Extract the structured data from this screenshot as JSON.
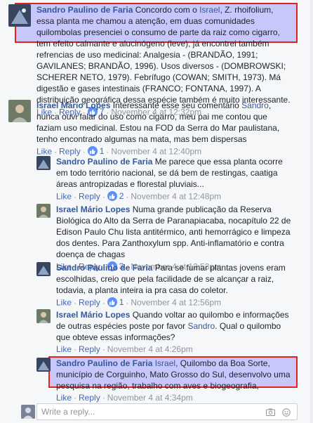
{
  "comments": [
    {
      "name": "Sandro Paulino de Faria",
      "text_lines": [
        " Concordo com o ",
        "Israel",
        ", Z. rhoifolium, essa planta me chamou a atenção, em duas comunidades quilombolas presenciei o consumo de parte da raiz como cigarro, tem efeito calmante e alucinógeno (leve), já encontrei também refrencias de uso medicinal: Analgesia - (BRANDÃO, 1991; GAVILANES; BRANDÃO, 1996). Usos diversos - (DOMBROWSKI; SCHERER NETO, 1979). Febrífugo (COWAN; SMITH, 1973). Má digestão e gases intestinais (FRANCO; FONTANA, 1997). A distribuição geográfica dessa espécie também é muito interessante."
      ],
      "like": "Like",
      "reply": "Reply",
      "likes": "7",
      "time": "November 4 at 12:32pm"
    },
    {
      "name": "Israel Mário Lopes",
      "text_a": " Interessante esse seu comentário ",
      "mention": "Sandro",
      "text_b": ", nunca ouvi falar do uso como cigarro, meu pai me contou que faziam uso medicinal. Estou na FOD da Serra do Mar paulistana, tenho encontrado algumas na mata, mas bem dispersas",
      "like": "Like",
      "reply": "Reply",
      "likes": "1",
      "time": "November 4 at 12:40pm"
    },
    {
      "name": "Sandro Paulino de Faria",
      "text": " Me parece que essa planta ocorre em todo território nacional, se dá bem de restingas, caatiga áreas antropizadas e florestal pluviais...",
      "like": "Like",
      "reply": "Reply",
      "likes": "2",
      "time": "November 4 at 12:48pm"
    },
    {
      "name": "Israel Mário Lopes",
      "text": " Numa grande publicação da Reserva Biológica do Alto da Serra de Paranapiacaba, nocapítulo 22 de Edison Paulo Chu lista antitérmico, anti hemorrágico e limpeza dos dentes. Para Zanthoxylum spp. Anti-inflamatório e contra doença de chagas",
      "like": "Like",
      "reply": "Reply",
      "likes": "3",
      "time": "November 4 at 12:53pm"
    },
    {
      "name": "Sandro Paulino de Faria",
      "text": " Para se fumar plantas jovens eram escolhidas, creio que pela facilidade de se alcançar a raiz, todavia, a planta inteira ia pra casa do coletor.",
      "like": "Like",
      "reply": "Reply",
      "likes": "1",
      "time": "November 4 at 12:56pm"
    },
    {
      "name": "Israel Mário Lopes",
      "text_a": " Quando voltar ao quilombo e informações de outras espécies poste por favor ",
      "mention": "Sandro",
      "text_b": ". Qual o quilombo que obteve essas informações?",
      "like": "Like",
      "reply": "Reply",
      "time": "November 4 at 4:26pm"
    },
    {
      "name": "Sandro Paulino de Faria",
      "mention": "Israel",
      "text_b": ", Quilombo da Boa Sorte, município de Corguinho, Mato Grosso do Sul, desenvolvo uma pesquisa na região, trabalho com aves e biogeografia,",
      "like": "Like",
      "reply": "Reply",
      "time": "November 4 at 4:34pm"
    }
  ],
  "reply_box": {
    "placeholder": "Write a reply..."
  },
  "colors": {
    "link": "#365899",
    "highlight_border": "#e2231a",
    "highlight_fill": "#a0a0ff"
  }
}
